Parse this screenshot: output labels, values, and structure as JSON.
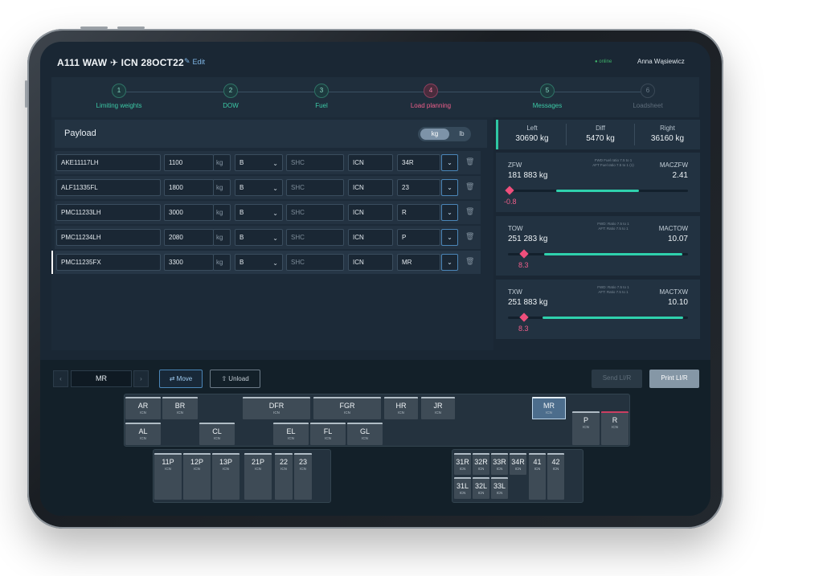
{
  "header": {
    "title": "A111 WAW ✈ ICN 28OCT22",
    "edit_label": "Edit",
    "status": "● online",
    "user": "Anna Wąsiewicz"
  },
  "steps": [
    {
      "num": "1",
      "label": "Limiting weights"
    },
    {
      "num": "2",
      "label": "DOW"
    },
    {
      "num": "3",
      "label": "Fuel"
    },
    {
      "num": "4",
      "label": "Load planning"
    },
    {
      "num": "5",
      "label": "Messages"
    },
    {
      "num": "6",
      "label": "Loadsheet"
    }
  ],
  "payload": {
    "title": "Payload",
    "unit_kg": "kg",
    "unit_lb": "lb",
    "rows": [
      {
        "id": "AKE11117LH",
        "weight": "1100",
        "unit": "kg",
        "cls": "B",
        "shc": "SHC",
        "dest": "ICN",
        "pos": "34R"
      },
      {
        "id": "ALF11335FL",
        "weight": "1800",
        "unit": "kg",
        "cls": "B",
        "shc": "SHC",
        "dest": "ICN",
        "pos": "23"
      },
      {
        "id": "PMC11233LH",
        "weight": "3000",
        "unit": "kg",
        "cls": "B",
        "shc": "SHC",
        "dest": "ICN",
        "pos": "R"
      },
      {
        "id": "PMC11234LH",
        "weight": "2080",
        "unit": "kg",
        "cls": "B",
        "shc": "SHC",
        "dest": "ICN",
        "pos": "P"
      },
      {
        "id": "PMC11235FX",
        "weight": "3300",
        "unit": "kg",
        "cls": "B",
        "shc": "SHC",
        "dest": "ICN",
        "pos": "MR"
      }
    ],
    "add_label": "+"
  },
  "balance": {
    "left_label": "Left",
    "left_value": "30690 kg",
    "diff_label": "Diff",
    "diff_value": "5470 kg",
    "right_label": "Right",
    "right_value": "36160 kg"
  },
  "weights": [
    {
      "label": "ZFW",
      "value": "181 883 kg",
      "note1": "FWD Fuel ratio 7.5 to 1",
      "note2": "AFT Fuel ratio 7.5 to 1 (1)",
      "mac_label": "MACZFW",
      "mac_value": "2.41",
      "marker": "-0.8",
      "marker_pct": 0.0,
      "range_start": 0.27,
      "range_end": 0.73
    },
    {
      "label": "TOW",
      "value": "251 283 kg",
      "note1": "FWD: Ratio 7.5 to 1",
      "note2": "AFT: Ratio 7.5 to 1",
      "mac_label": "MACTOW",
      "mac_value": "10.07",
      "marker": "8.3",
      "marker_pct": 0.08,
      "range_start": 0.2,
      "range_end": 0.97
    },
    {
      "label": "TXW",
      "value": "251 883 kg",
      "note1": "FWD: Ratio 7.5 to 1",
      "note2": "AFT: Ratio 7.5 to 1",
      "mac_label": "MACTXW",
      "mac_value": "10.10",
      "marker": "8.3",
      "marker_pct": 0.08,
      "range_start": 0.19,
      "range_end": 0.97
    }
  ],
  "toolbar": {
    "prev": "‹",
    "next": "›",
    "position_value": "MR",
    "move_label": "⇄ Move",
    "unload_label": "⇧ Unload",
    "send_label": "Send LI/R",
    "print_label": "Print LI/R"
  },
  "upper_deck": [
    {
      "name": "AR",
      "dest": "ICN"
    },
    {
      "name": "BR",
      "dest": "ICN"
    },
    {
      "name": "DFR",
      "dest": "ICN"
    },
    {
      "name": "FGR",
      "dest": "ICN"
    },
    {
      "name": "HR",
      "dest": "ICN"
    },
    {
      "name": "JR",
      "dest": "ICN"
    },
    {
      "name": "MR",
      "dest": "ICN"
    },
    {
      "name": "P",
      "dest": "ICN"
    },
    {
      "name": "R",
      "dest": "ICN"
    },
    {
      "name": "AL",
      "dest": "ICN"
    },
    {
      "name": "CL",
      "dest": "ICN"
    },
    {
      "name": "EL",
      "dest": "ICN"
    },
    {
      "name": "FL",
      "dest": "ICN"
    },
    {
      "name": "GL",
      "dest": "ICN"
    }
  ],
  "fwd_hold": [
    {
      "name": "11P",
      "dest": "ICN"
    },
    {
      "name": "12P",
      "dest": "ICN"
    },
    {
      "name": "13P",
      "dest": "ICN"
    },
    {
      "name": "21P",
      "dest": "ICN"
    },
    {
      "name": "22",
      "dest": "ICN"
    },
    {
      "name": "23",
      "dest": "ICN"
    }
  ],
  "aft_hold": [
    {
      "name": "31R",
      "dest": "ICN"
    },
    {
      "name": "32R",
      "dest": "ICN"
    },
    {
      "name": "33R",
      "dest": "ICN"
    },
    {
      "name": "34R",
      "dest": "ICN"
    },
    {
      "name": "41",
      "dest": "ICN"
    },
    {
      "name": "42",
      "dest": "ICN"
    },
    {
      "name": "31L",
      "dest": "ICN"
    },
    {
      "name": "32L",
      "dest": "ICN"
    },
    {
      "name": "33L",
      "dest": "ICN"
    }
  ],
  "colors": {
    "accent": "#2fd1ad",
    "active_step": "#ef5f8b",
    "primary": "#3d8ddb",
    "background": "#1a2734"
  }
}
